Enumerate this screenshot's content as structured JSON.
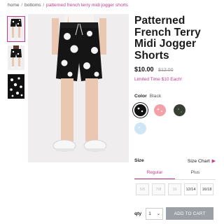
{
  "breadcrumb": {
    "home": "home",
    "bottoms": "bottoms",
    "current": "patterned french terry midi jogger shorts",
    "separator": "/"
  },
  "product": {
    "title": "Patterned French Terry Midi Jogger Shorts",
    "price": "$10.00",
    "old_price": "$12.00",
    "promo": "Limited Time $10 Each!"
  },
  "color": {
    "label": "Color",
    "selected": "Black",
    "swatches": [
      {
        "name": "Black",
        "hex": "#111111"
      },
      {
        "name": "Pink",
        "hex": "#f4a0a8"
      },
      {
        "name": "Olive",
        "hex": "#3a3f35"
      },
      {
        "name": "Light Blue",
        "hex": "#cfe6f5"
      }
    ]
  },
  "size": {
    "label": "Size",
    "chart_label": "Size Chart",
    "tabs": [
      "Regular",
      "Plus"
    ],
    "active_tab": "Regular",
    "options": [
      {
        "label": "5/6",
        "available": false
      },
      {
        "label": "7/8",
        "available": false
      },
      {
        "label": "10",
        "available": false
      },
      {
        "label": "12/14",
        "available": true
      },
      {
        "label": "16/18",
        "available": true
      }
    ]
  },
  "cart": {
    "qty_label": "qty",
    "qty_value": "1",
    "add_label": "ADD TO CART"
  },
  "colors": {
    "accent": "#c33b8f",
    "button_gray": "#9aa0a6"
  }
}
